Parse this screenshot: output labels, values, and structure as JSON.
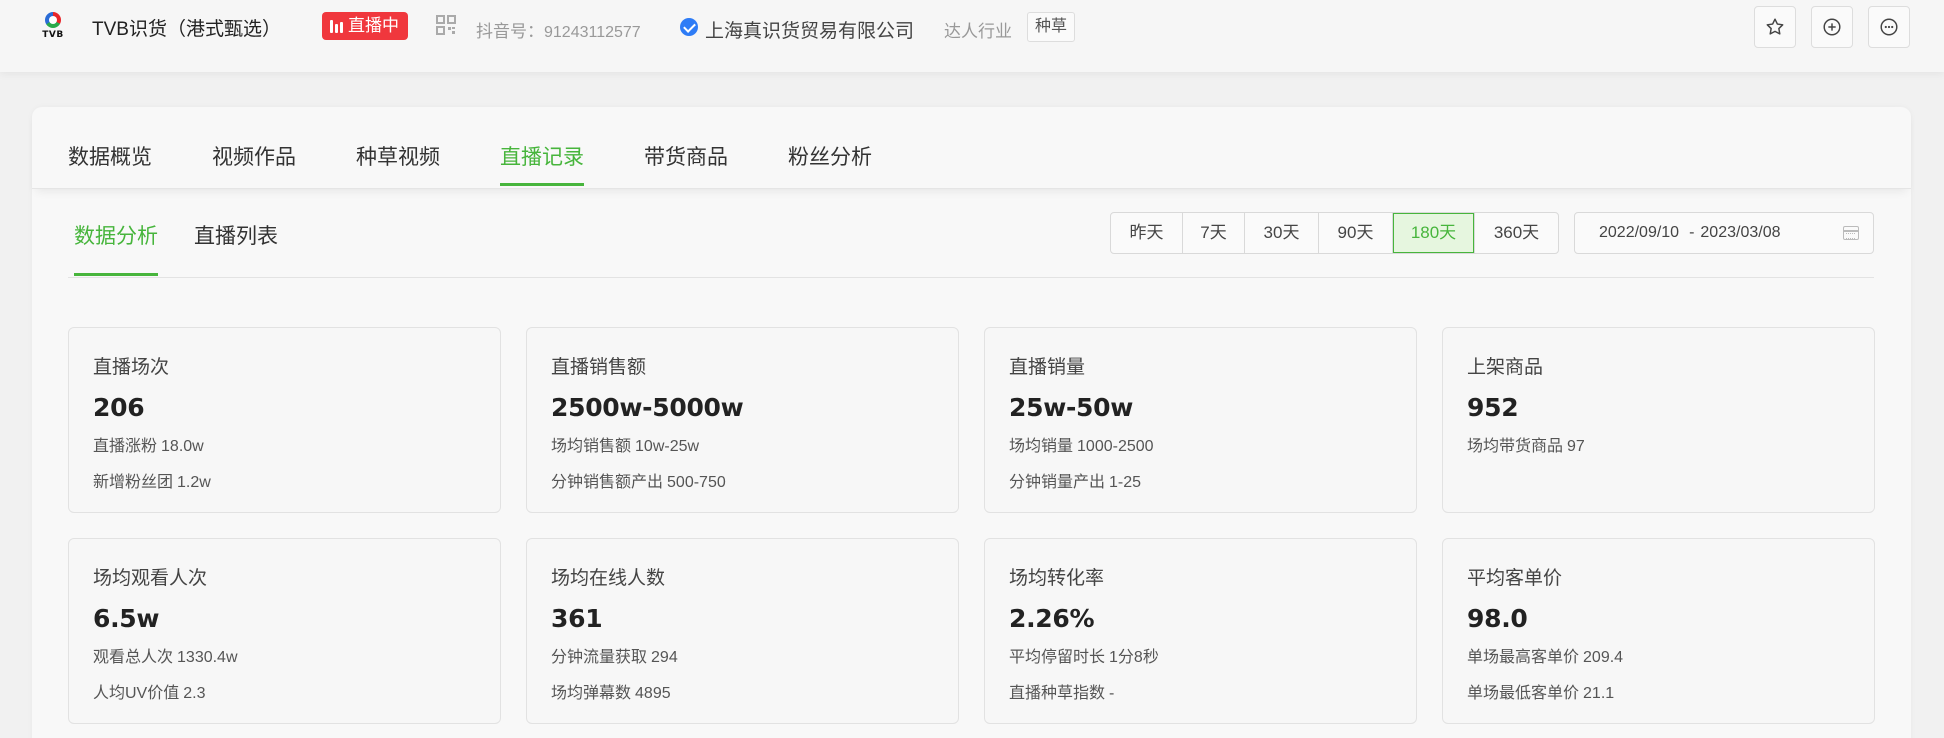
{
  "header": {
    "logo_text": "TVB",
    "shop_name": "TVB识货（港式甄选）",
    "live_badge": "直播中",
    "douyin_id_label": "抖音号：",
    "douyin_id": "91243112577",
    "company": "上海真识货贸易有限公司",
    "industry_label": "达人行业",
    "industry_tag": "种草",
    "icons": [
      "star-icon",
      "plus-circle-icon",
      "more-icon"
    ]
  },
  "tabs": [
    {
      "label": "数据概览"
    },
    {
      "label": "视频作品"
    },
    {
      "label": "种草视频"
    },
    {
      "label": "直播记录",
      "active": true
    },
    {
      "label": "带货商品"
    },
    {
      "label": "粉丝分析"
    }
  ],
  "subtabs": [
    {
      "label": "数据分析",
      "active": true
    },
    {
      "label": "直播列表"
    }
  ],
  "periods": [
    {
      "label": "昨天"
    },
    {
      "label": "7天"
    },
    {
      "label": "30天"
    },
    {
      "label": "90天"
    },
    {
      "label": "180天",
      "active": true
    },
    {
      "label": "360天"
    }
  ],
  "date_range": {
    "start": "2022/09/10",
    "separator": "-",
    "end": "2023/03/08"
  },
  "stats": [
    {
      "label": "直播场次",
      "value": "206",
      "subs": [
        {
          "k": "直播涨粉",
          "v": "18.0w"
        },
        {
          "k": "新增粉丝团",
          "v": "1.2w"
        }
      ]
    },
    {
      "label": "直播销售额",
      "value": "2500w-5000w",
      "subs": [
        {
          "k": "场均销售额",
          "v": "10w-25w"
        },
        {
          "k": "分钟销售额产出",
          "v": "500-750"
        }
      ]
    },
    {
      "label": "直播销量",
      "value": "25w-50w",
      "subs": [
        {
          "k": "场均销量",
          "v": "1000-2500"
        },
        {
          "k": "分钟销量产出",
          "v": "1-25"
        }
      ]
    },
    {
      "label": "上架商品",
      "value": "952",
      "subs": [
        {
          "k": "场均带货商品",
          "v": "97"
        }
      ]
    },
    {
      "label": "场均观看人次",
      "value": "6.5w",
      "subs": [
        {
          "k": "观看总人次",
          "v": "1330.4w"
        },
        {
          "k": "人均UV价值",
          "v": "2.3"
        }
      ]
    },
    {
      "label": "场均在线人数",
      "value": "361",
      "subs": [
        {
          "k": "分钟流量获取",
          "v": "294"
        },
        {
          "k": "场均弹幕数",
          "v": "4895"
        }
      ]
    },
    {
      "label": "场均转化率",
      "value": "2.26%",
      "subs": [
        {
          "k": "平均停留时长",
          "v": "1分8秒"
        },
        {
          "k": "直播种草指数",
          "v": "-"
        }
      ]
    },
    {
      "label": "平均客单价",
      "value": "98.0",
      "subs": [
        {
          "k": "单场最高客单价",
          "v": "209.4"
        },
        {
          "k": "单场最低客单价",
          "v": "21.1"
        }
      ]
    }
  ],
  "colors": {
    "accent": "#47b53c",
    "live": "#f0373d",
    "verify": "#2e7cf6"
  }
}
